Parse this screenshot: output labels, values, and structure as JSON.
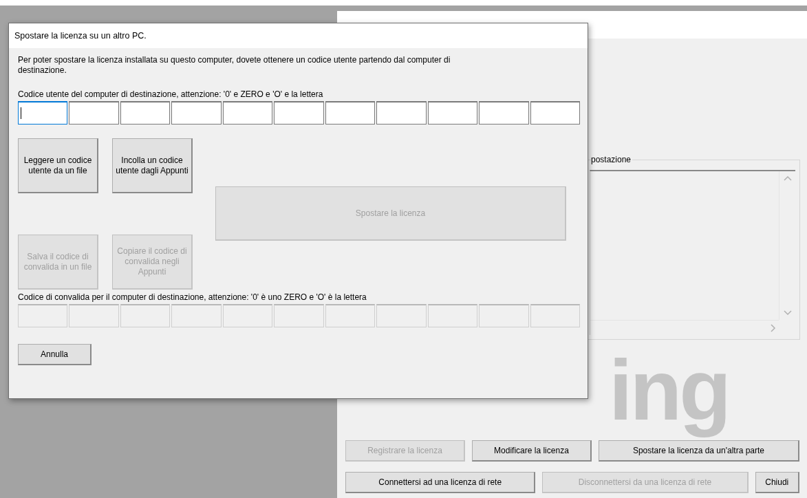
{
  "main_window": {
    "group_label": "postazione",
    "logo_text": "ing",
    "button_rows": [
      [
        {
          "label": "Registrare la licenza",
          "disabled": true
        },
        {
          "label": "Modificare la licenza",
          "disabled": false
        },
        {
          "label": "Spostare la licenza da un'altra parte",
          "disabled": false
        }
      ],
      [
        {
          "label": "Connettersi ad una licenza di rete",
          "disabled": false
        },
        {
          "label": "Disconnettersi da una licenza di rete",
          "disabled": true
        },
        {
          "label": "Chiudi",
          "disabled": false
        }
      ]
    ]
  },
  "dialog": {
    "title": "Spostare la licenza su un altro PC.",
    "description": "Per poter spostare la licenza installata su questo computer, dovete ottenere un codice utente partendo dal computer di destinazione.",
    "user_code_label": "Codice utente del computer di destinazione, attenzione: '0' e ZERO e 'O' e la lettera",
    "user_code_fields": [
      {
        "focused": true,
        "disabled": false
      },
      {
        "focused": false,
        "disabled": false
      },
      {
        "focused": false,
        "disabled": false
      },
      {
        "focused": false,
        "disabled": false
      },
      {
        "focused": false,
        "disabled": false
      },
      {
        "focused": false,
        "disabled": false
      },
      {
        "focused": false,
        "disabled": false
      },
      {
        "focused": false,
        "disabled": false
      },
      {
        "focused": false,
        "disabled": false
      },
      {
        "focused": false,
        "disabled": false
      },
      {
        "focused": false,
        "disabled": false
      }
    ],
    "input_buttons": [
      {
        "label": "Leggere un codice utente da un file",
        "disabled": false
      },
      {
        "label": "Incolla un codice utente dagli Appunti",
        "disabled": false
      }
    ],
    "move_button": {
      "label": "Spostare la licenza",
      "disabled": true
    },
    "output_buttons": [
      {
        "label": "Salva il codice di convalida in un file",
        "disabled": true
      },
      {
        "label": "Copiare il codice di convalida negli Appunti",
        "disabled": true
      }
    ],
    "validation_code_label": "Codice di convalida per il computer di destinazione, attenzione: '0' è uno ZERO e 'O' è la lettera",
    "validation_code_fields": [
      {
        "focused": false,
        "disabled": true
      },
      {
        "focused": false,
        "disabled": true
      },
      {
        "focused": false,
        "disabled": true
      },
      {
        "focused": false,
        "disabled": true
      },
      {
        "focused": false,
        "disabled": true
      },
      {
        "focused": false,
        "disabled": true
      },
      {
        "focused": false,
        "disabled": true
      },
      {
        "focused": false,
        "disabled": true
      },
      {
        "focused": false,
        "disabled": true
      },
      {
        "focused": false,
        "disabled": true
      },
      {
        "focused": false,
        "disabled": true
      }
    ],
    "cancel_button": {
      "label": "Annulla",
      "disabled": false
    }
  }
}
